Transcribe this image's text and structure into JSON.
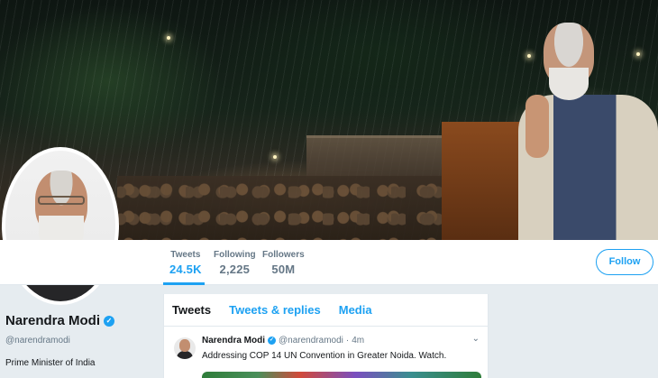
{
  "profile": {
    "name": "Narendra Modi",
    "handle": "@narendramodi",
    "bio": "Prime Minister of India"
  },
  "stats": [
    {
      "label": "Tweets",
      "value": "24.5K"
    },
    {
      "label": "Following",
      "value": "2,225"
    },
    {
      "label": "Followers",
      "value": "50M"
    }
  ],
  "actions": {
    "follow_label": "Follow"
  },
  "tabs": [
    "Tweets",
    "Tweets & replies",
    "Media"
  ],
  "tweet": {
    "name": "Narendra Modi",
    "handle": "@narendramodi",
    "separator": "·",
    "time": "4m",
    "text": "Addressing COP 14 UN Convention in Greater Noida. Watch."
  },
  "colors": {
    "accent": "#1da1f2",
    "background": "#e6ecf0"
  },
  "icons": {
    "verified": "verified-badge-icon",
    "menu": "chevron-down-icon"
  }
}
